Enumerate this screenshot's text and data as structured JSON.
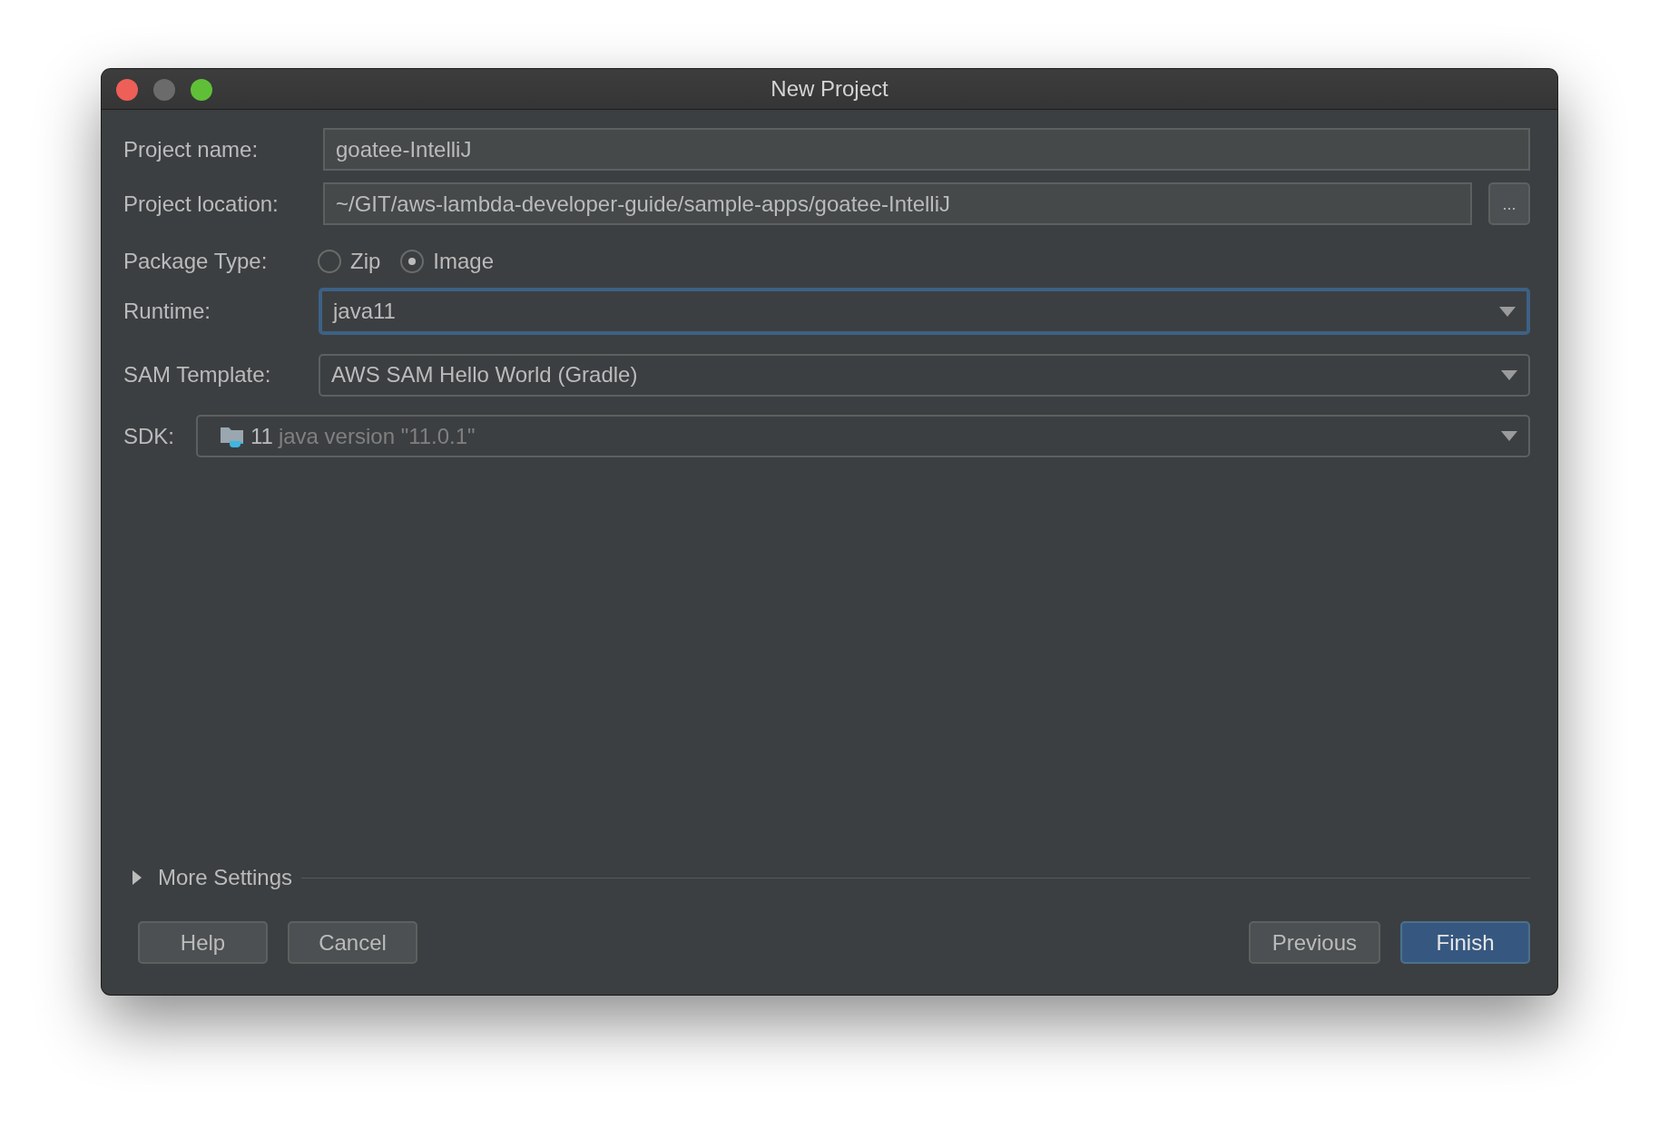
{
  "window": {
    "title": "New Project"
  },
  "form": [
    {
      "kind": "text",
      "label": "Project name:",
      "value": "goatee-IntelliJ"
    },
    {
      "kind": "browse",
      "label": "Project location:",
      "value": "~/GIT/aws-lambda-developer-guide/sample-apps/goatee-IntelliJ",
      "button": "..."
    },
    {
      "kind": "radio",
      "label": "Package Type:",
      "options": [
        {
          "label": "Zip",
          "selected": false
        },
        {
          "label": "Image",
          "selected": true
        }
      ]
    },
    {
      "kind": "select",
      "label": "Runtime:",
      "value": "java11",
      "focused": true
    },
    {
      "kind": "select",
      "label": "SAM Template:",
      "value": "AWS SAM Hello World (Gradle)",
      "focused": false
    },
    {
      "kind": "sdk",
      "label": "SDK:",
      "version": "11",
      "detail": "java version \"11.0.1\""
    }
  ],
  "more_settings": {
    "label": "More Settings",
    "expanded": false
  },
  "buttons_left": [
    {
      "label": "Help",
      "default": false
    },
    {
      "label": "Cancel",
      "default": false
    }
  ],
  "buttons_right": [
    {
      "label": "Previous",
      "default": false
    },
    {
      "label": "Finish",
      "default": true
    }
  ]
}
